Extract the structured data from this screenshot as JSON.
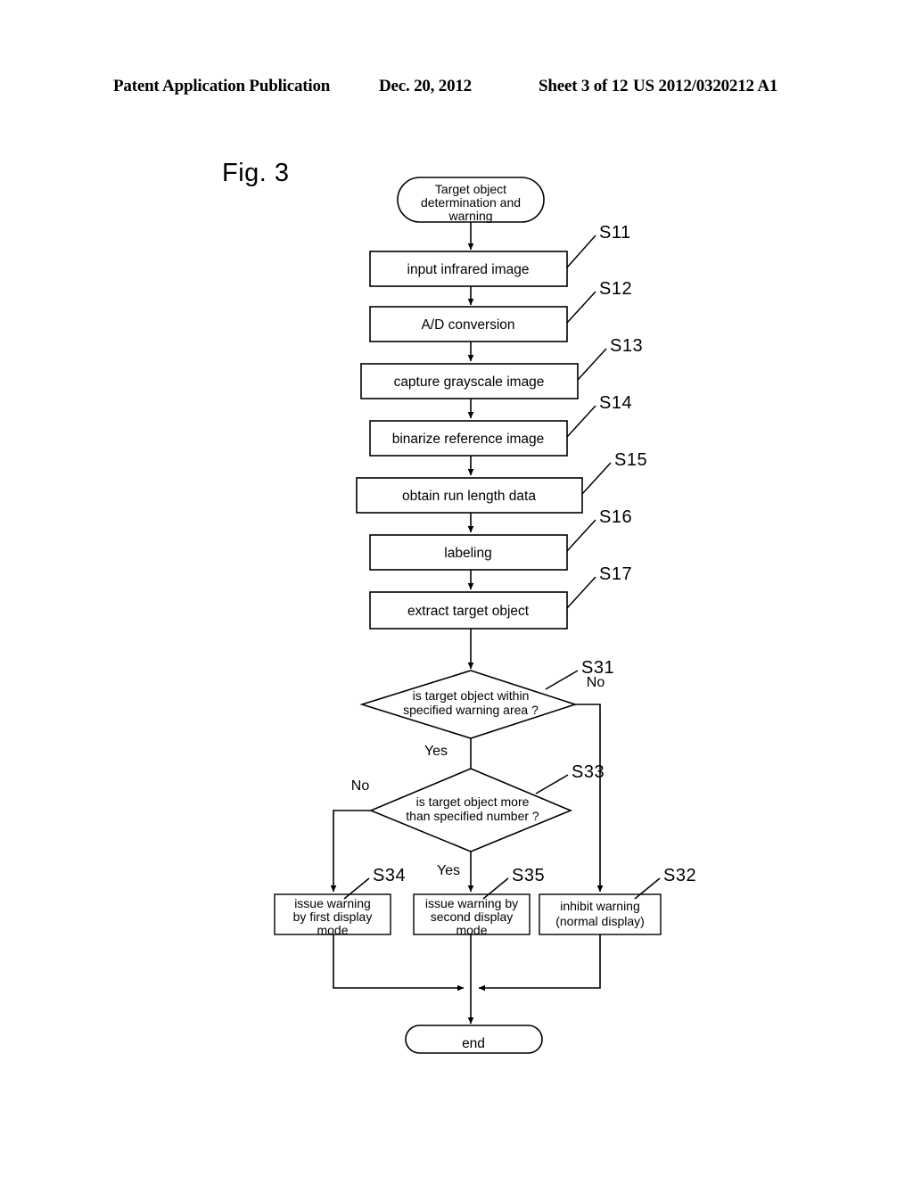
{
  "header": {
    "publication": "Patent Application Publication",
    "date": "Dec. 20, 2012",
    "sheet": "Sheet 3 of 12",
    "patent_number": "US 2012/0320212 A1"
  },
  "figure": {
    "label": "Fig. 3",
    "start_node": {
      "id": "start",
      "lines": [
        "Target object",
        "determination and",
        "warning"
      ]
    },
    "end_node": {
      "id": "end",
      "label": "end"
    },
    "process_steps": [
      {
        "step": "S11",
        "label": "input infrared image"
      },
      {
        "step": "S12",
        "label": "A/D conversion"
      },
      {
        "step": "S13",
        "label": "capture grayscale image"
      },
      {
        "step": "S14",
        "label": "binarize reference image"
      },
      {
        "step": "S15",
        "label": "obtain run length data"
      },
      {
        "step": "S16",
        "label": "labeling"
      },
      {
        "step": "S17",
        "label": "extract target object"
      }
    ],
    "decisions": [
      {
        "step": "S31",
        "lines": [
          "is target object within",
          "specified warning area ?"
        ],
        "yes_label": "Yes",
        "no_label": "No"
      },
      {
        "step": "S33",
        "lines": [
          "is target object more",
          "than specified number ?"
        ],
        "yes_label": "Yes",
        "no_label": "No"
      }
    ],
    "outcome_steps": [
      {
        "step": "S34",
        "lines": [
          "issue warning",
          "by first display",
          "mode"
        ]
      },
      {
        "step": "S35",
        "lines": [
          "issue warning by",
          "second display",
          "mode"
        ]
      },
      {
        "step": "S32",
        "lines": [
          "inhibit warning",
          "(normal display)"
        ]
      }
    ]
  }
}
